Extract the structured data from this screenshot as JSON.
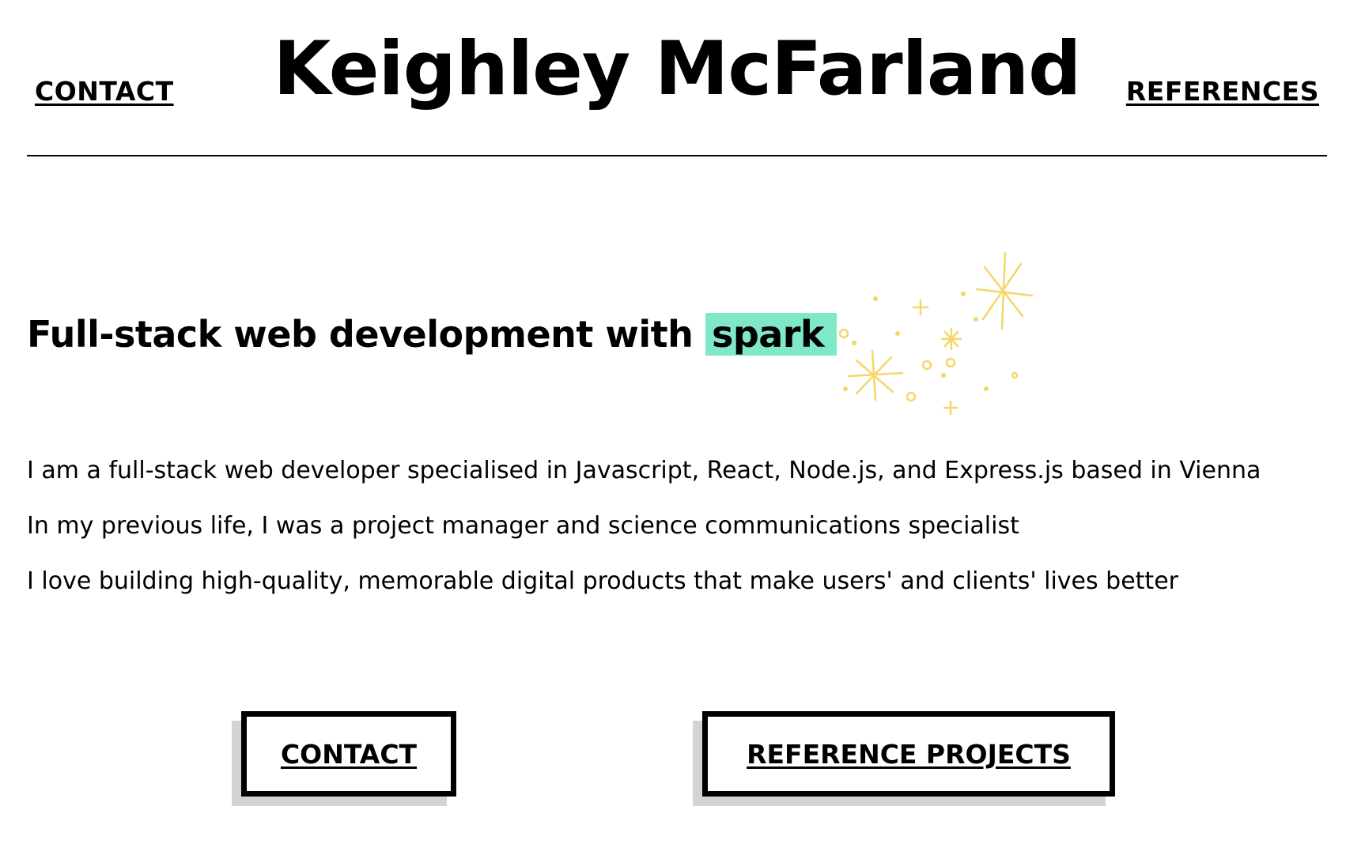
{
  "header": {
    "nav_contact": "CONTACT",
    "title": "Keighley McFarland",
    "nav_references": "REFERENCES"
  },
  "hero": {
    "heading_prefix": "Full-stack web development with ",
    "heading_highlight": "spark",
    "highlight_color": "#7fe8c9",
    "sparkle_color": "#f2d76b"
  },
  "intro": {
    "lines": [
      "I am a full-stack web developer specialised in Javascript, React, Node.js, and Express.js based in Vienna",
      "In my previous life, I was a project manager and science communications specialist",
      "I love building high-quality, memorable digital products that make users' and clients' lives better"
    ]
  },
  "buttons": {
    "contact_label": "CONTACT",
    "references_label": "REFERENCE PROJECTS",
    "shadow_color": "#d3d3d3"
  }
}
